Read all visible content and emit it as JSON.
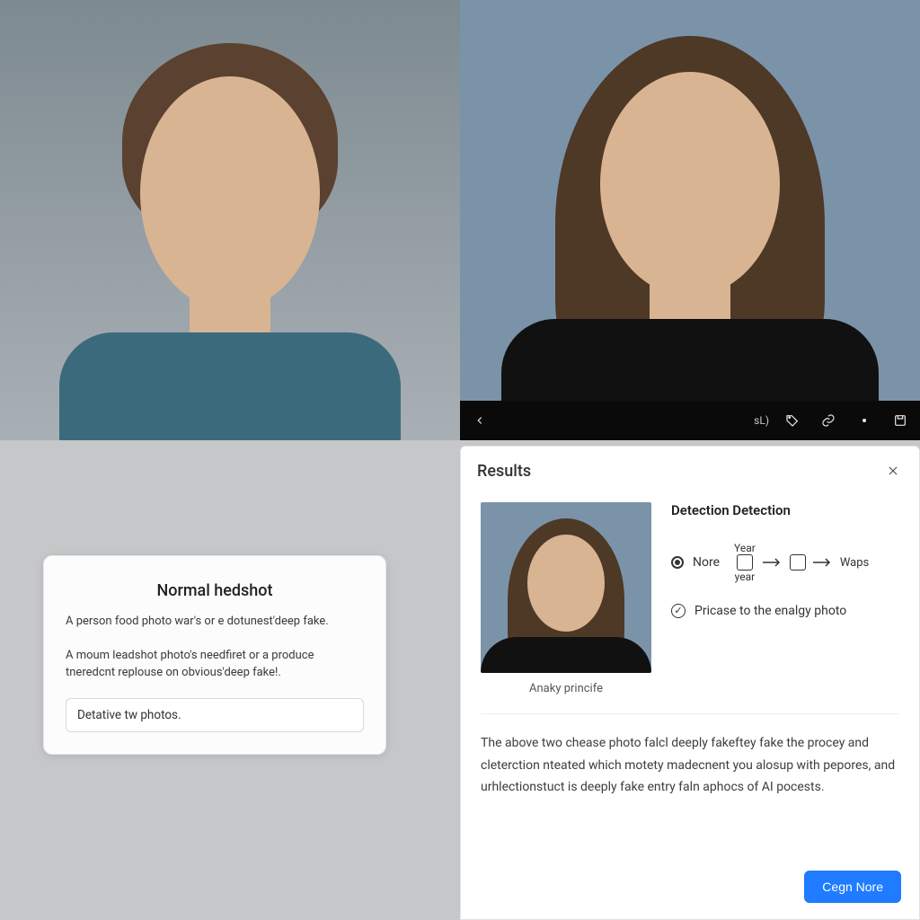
{
  "toolbar": {
    "label": "sL)"
  },
  "left_card": {
    "title": "Normal hedshot",
    "line1": "A person food photo war's or e dotunest'deep fake.",
    "line2": "A moum leadshot photo's needfiret or a produce tneredcnt replouse on obvious'deep fake!.",
    "input_text": "Detative tw photos."
  },
  "results": {
    "title": "Results",
    "thumb_caption": "Anaky princife",
    "detection_heading": "Detection Detection",
    "radio_label": "Nore",
    "flow_top": "Year",
    "flow_bottom": "year",
    "flow_end": "Waps",
    "check_label": "Pricase to the enalgy photo",
    "description": "The above two chease photo falcl deeply fakeftey fake the procey and cleterction nteated which motety madecnent you alosup with pepores, and urhlectionstuct is deeply fake entry faln aphocs of AI pocests.",
    "cta": "Cegn Nore"
  }
}
